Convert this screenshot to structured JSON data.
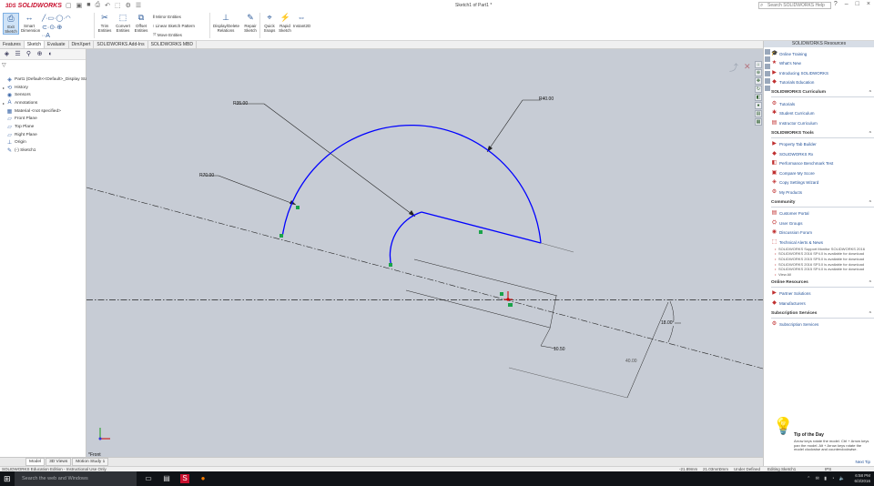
{
  "app": {
    "brand": "SOLIDWORKS",
    "brand_prefix": "3DS",
    "doc_title": "Sketch1 of Part1 *",
    "search_placeholder": "Search SOLIDWORKS Help",
    "window_controls": [
      "?",
      "–",
      "□",
      "×"
    ]
  },
  "ribbon": {
    "exit_sketch": "Exit Sketch",
    "smart_dimension": "Smart Dimension",
    "trim_entities": "Trim Entities",
    "convert_entities": "Convert Entities",
    "offset_entities": "Offset Entities",
    "mirror_entities": "Mirror Entities",
    "linear_pattern": "Linear Sketch Pattern",
    "move_entities": "Move Entities",
    "display_relations": "Display/Delete Relations",
    "repair_sketch": "Repair Sketch",
    "quick_snaps": "Quick Snaps",
    "rapid_sketch": "Rapid Sketch",
    "instant2d": "Instant2D"
  },
  "tabs": [
    "Features",
    "Sketch",
    "Evaluate",
    "DimXpert",
    "SOLIDWORKS Add-Ins",
    "SOLIDWORKS MBD"
  ],
  "feature_tree": [
    {
      "icon": "part-icon",
      "label": "Part1 (Default<<Default>_Display State 1>)"
    },
    {
      "icon": "history-icon",
      "label": "History"
    },
    {
      "icon": "sensors-icon",
      "label": "Sensors"
    },
    {
      "icon": "annotations-icon",
      "label": "Annotations"
    },
    {
      "icon": "material-icon",
      "label": "Material <not specified>"
    },
    {
      "icon": "plane-icon",
      "label": "Front Plane"
    },
    {
      "icon": "plane-icon",
      "label": "Top Plane"
    },
    {
      "icon": "plane-icon",
      "label": "Right Plane"
    },
    {
      "icon": "origin-icon",
      "label": "Origin"
    },
    {
      "icon": "sketch-icon",
      "label": "(-) Sketch1"
    }
  ],
  "sketch": {
    "dimensions": {
      "r35": "R35.00",
      "r40": "R40.00",
      "r70": "R70.00",
      "angle": "18.00°",
      "d10": "10.50",
      "d40": "40.00"
    },
    "view_label": "*Front"
  },
  "model_tabs": [
    "Model",
    "3D Views",
    "Motion Study 1"
  ],
  "status": {
    "left": "SOLIDWORKS Education Edition - Instructional Use Only",
    "x": "-21.89mm",
    "y": "21.03mm",
    "z": "0mm",
    "state": "Under Defined",
    "editing": "Editing Sketch1",
    "units": "IPS"
  },
  "task_pane": {
    "header": "SOLIDWORKS Resources",
    "sections": [
      {
        "title": "",
        "links": [
          "Online Training",
          "What's New",
          "Introducing SOLIDWORKS",
          "Tutorials Education"
        ]
      },
      {
        "title": "SOLIDWORKS Curriculum",
        "links": [
          "Tutorials",
          "Student Curriculum",
          "Instructor Curriculum"
        ]
      },
      {
        "title": "SOLIDWORKS Tools",
        "links": [
          "Property Tab Builder",
          "SOLIDWORKS Rx",
          "Performance Benchmark Test",
          "Compare My Score",
          "Copy Settings Wizard",
          "My Products"
        ]
      },
      {
        "title": "Community",
        "links": [
          "Customer Portal",
          "User Groups",
          "Discussion Forum",
          "Technical Alerts & News"
        ]
      }
    ],
    "news": [
      "SOLIDWORKS Support Monitor SOLIDWORKS 2016",
      "SOLIDWORKS 2016 SP4.0 is available for download",
      "SOLIDWORKS 2015 SP5.0 is available for download",
      "SOLIDWORKS 2016 SP3.0 is available for download",
      "SOLIDWORKS 2015 SP4.0 is available for download"
    ],
    "view_all": "View All",
    "online_resources": {
      "title": "Online Resources",
      "links": [
        "Partner Solutions",
        "Manufacturers"
      ]
    },
    "subscription": {
      "title": "Subscription Services",
      "links": [
        "Subscription Services"
      ]
    },
    "tip": {
      "title": "Tip of the Day",
      "text": "Arrow keys rotate the model. Ctrl + Arrow keys pan the model. Alt + Arrow keys rotate the model clockwise and counterclockwise.",
      "next": "Next Tip"
    }
  },
  "taskbar": {
    "search": "Search the web and Windows",
    "time": "6:58 PM",
    "date": "6/3/2016"
  },
  "colors": {
    "sketch_blue": "#0000ff",
    "relation_green": "#1aa34a",
    "viewport_bg": "#c7ccd5",
    "brand_red": "#c8102e"
  }
}
